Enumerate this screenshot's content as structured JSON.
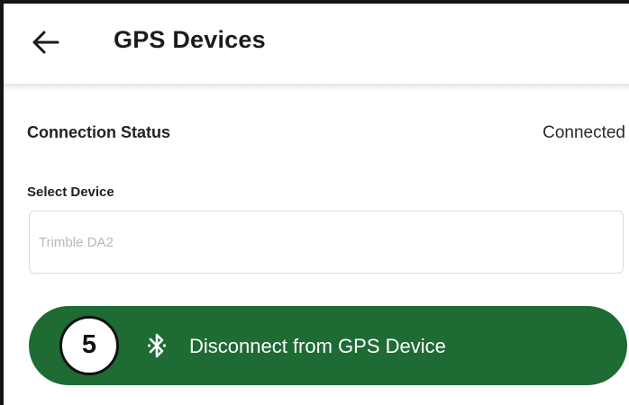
{
  "header": {
    "title": "GPS Devices",
    "back_icon": "arrow-left-icon"
  },
  "connection": {
    "label": "Connection Status",
    "value": "Connected"
  },
  "device_select": {
    "label": "Select Device",
    "value": "Trimble DA2"
  },
  "action_button": {
    "label": "Disconnect from GPS Device",
    "icon": "bluetooth-icon",
    "color": "#1e6b34"
  },
  "step_badge": {
    "number": "5"
  }
}
